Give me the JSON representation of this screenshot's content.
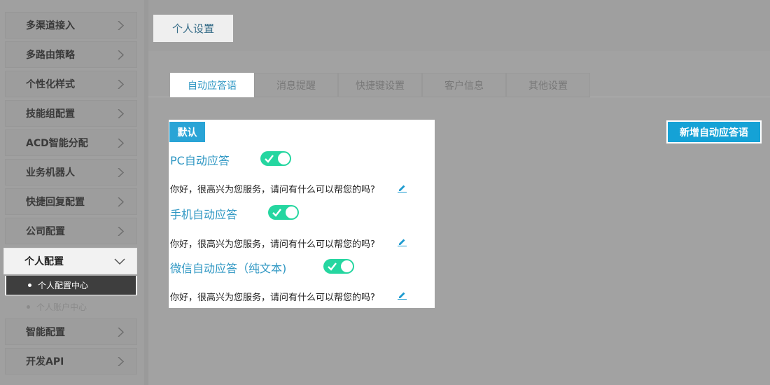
{
  "sidebar": {
    "items": [
      {
        "label": "多渠道接入"
      },
      {
        "label": "多路由策略"
      },
      {
        "label": "个性化样式"
      },
      {
        "label": "技能组配置"
      },
      {
        "label": "ACD智能分配"
      },
      {
        "label": "业务机器人"
      },
      {
        "label": "快捷回复配置"
      },
      {
        "label": "公司配置"
      },
      {
        "label": "个人配置",
        "open": true
      },
      {
        "label": "智能配置"
      },
      {
        "label": "开发API"
      }
    ],
    "sub_items": [
      {
        "label": "个人配置中心",
        "active": true
      },
      {
        "label": "个人账户中心",
        "active": false
      }
    ]
  },
  "header": {
    "tab_label": "个人设置"
  },
  "tabs": [
    {
      "label": "自动应答语",
      "active": true
    },
    {
      "label": "消息提醒",
      "active": false
    },
    {
      "label": "快捷键设置",
      "active": false
    },
    {
      "label": "客户信息",
      "active": false
    },
    {
      "label": "其他设置",
      "active": false
    }
  ],
  "panel": {
    "badge": "默认",
    "replies": [
      {
        "title": "PC自动应答",
        "enabled": true,
        "text": "你好，很高兴为您服务，请问有什么可以帮您的吗?"
      },
      {
        "title": "手机自动应答",
        "enabled": true,
        "text": "你好，很高兴为您服务，请问有什么可以帮您的吗?"
      },
      {
        "title": "微信自动应答（纯文本)",
        "enabled": true,
        "text": "你好，很高兴为您服务，请问有什么可以帮您的吗?"
      }
    ]
  },
  "actions": {
    "new_reply_label": "新增自动应答语"
  },
  "colors": {
    "accent": "#29a4d6",
    "toggle_on": "#25d6a0",
    "button": "#15a2d6"
  },
  "icons": {
    "menu_collapsed": "chevron-right-icon",
    "menu_open": "chevron-down-icon",
    "toggle_on": "check-icon",
    "edit": "pencil-icon"
  }
}
